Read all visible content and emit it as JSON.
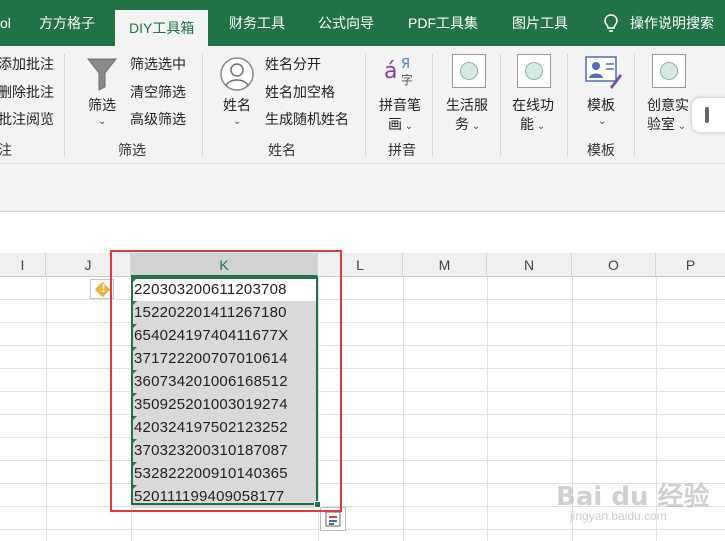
{
  "tabs": [
    "ol",
    "方方格子",
    "DIY工具箱",
    "财务工具",
    "公式向导",
    "PDF工具集",
    "图片工具"
  ],
  "active_tab_index": 2,
  "help_label": "操作说明搜索",
  "ribbon": {
    "comments": {
      "items": [
        "添加批注",
        "删除批注",
        "批注阅览"
      ],
      "title": "注"
    },
    "filter": {
      "big_label": "筛选",
      "items": [
        "筛选选中",
        "清空筛选",
        "高级筛选"
      ],
      "title": "筛选"
    },
    "name": {
      "big_label": "姓名",
      "items": [
        "姓名分开",
        "姓名加空格",
        "生成随机姓名"
      ],
      "title": "姓名"
    },
    "pinyin": {
      "big_label_1": "拼音笔",
      "big_label_2": "画",
      "title": "拼音"
    },
    "life": {
      "label_1": "生活服",
      "label_2": "务"
    },
    "online": {
      "label_1": "在线功",
      "label_2": "能"
    },
    "template": {
      "big_label": "模板",
      "title": "模板"
    },
    "lab": {
      "label_1": "创意实",
      "label_2": "验室"
    }
  },
  "columns": [
    "I",
    "J",
    "K",
    "L",
    "M",
    "N",
    "O",
    "P"
  ],
  "selected_column": "K",
  "cells_k": [
    "220303200611203708",
    "152202201411267180",
    "65402419740411677X",
    "371722200707010614",
    "360734201006168512",
    "350925201003019274",
    "420324197502123252",
    "370323200310187087",
    "532822200910140365",
    "520111199409058177"
  ],
  "watermark": {
    "text": "Bai du 经验",
    "url": "jingyan.baidu.com"
  },
  "colors": {
    "brand_green": "#217346",
    "highlight_red": "#e0393e",
    "selection_fill": "#d9d9d9"
  }
}
